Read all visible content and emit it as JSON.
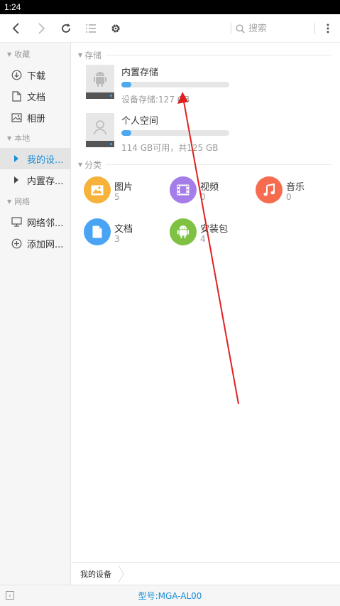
{
  "status_bar": {
    "time": "1:24"
  },
  "toolbar": {
    "back_icon": "chevron-left-icon",
    "forward_icon": "chevron-right-icon",
    "refresh_icon": "refresh-icon",
    "list_view_icon": "list-icon",
    "settings_icon": "gear-icon",
    "search": {
      "placeholder": "搜索",
      "value": ""
    },
    "more_icon": "more-vertical-icon"
  },
  "sidebar": {
    "sections": [
      {
        "label": "收藏"
      },
      {
        "label": "本地"
      },
      {
        "label": "网络"
      }
    ],
    "favorites": [
      {
        "label": "下载",
        "icon": "download-icon"
      },
      {
        "label": "文档",
        "icon": "document-icon"
      },
      {
        "label": "相册",
        "icon": "image-icon"
      }
    ],
    "local": [
      {
        "label": "我的设...",
        "icon": "triangle-right-icon",
        "active": true
      },
      {
        "label": "内置存...",
        "icon": "triangle-right-icon",
        "active": false
      }
    ],
    "network": [
      {
        "label": "网络邻...",
        "icon": "monitor-icon"
      },
      {
        "label": "添加网...",
        "icon": "add-circle-icon"
      }
    ]
  },
  "main": {
    "storage_section": {
      "label": "存储"
    },
    "storage": [
      {
        "title": "内置存储",
        "subtitle": "设备存储:127 GB",
        "used_fraction": 0.09,
        "icon": "android-icon"
      },
      {
        "title": "个人空间",
        "subtitle": "114 GB可用，共125 GB",
        "used_fraction": 0.09,
        "icon": "person-icon"
      }
    ],
    "category_section": {
      "label": "分类"
    },
    "categories": [
      {
        "label": "图片",
        "count": "5",
        "icon": "picture-icon",
        "color": "#f6b23a"
      },
      {
        "label": "视频",
        "count": "0",
        "icon": "film-icon",
        "color": "#a57de8"
      },
      {
        "label": "音乐",
        "count": "0",
        "icon": "music-note-icon",
        "color": "#f76b4f"
      },
      {
        "label": "文档",
        "count": "3",
        "icon": "document-icon",
        "color": "#4aa4f4"
      },
      {
        "label": "安装包",
        "count": "4",
        "icon": "android-icon",
        "color": "#7fc143"
      }
    ]
  },
  "breadcrumb": {
    "items": [
      "我的设备"
    ]
  },
  "bottom_bar": {
    "model": "型号:MGA-AL00",
    "collapse_icon": "collapse-left-icon"
  },
  "annotation": {
    "color": "#e0201f"
  }
}
